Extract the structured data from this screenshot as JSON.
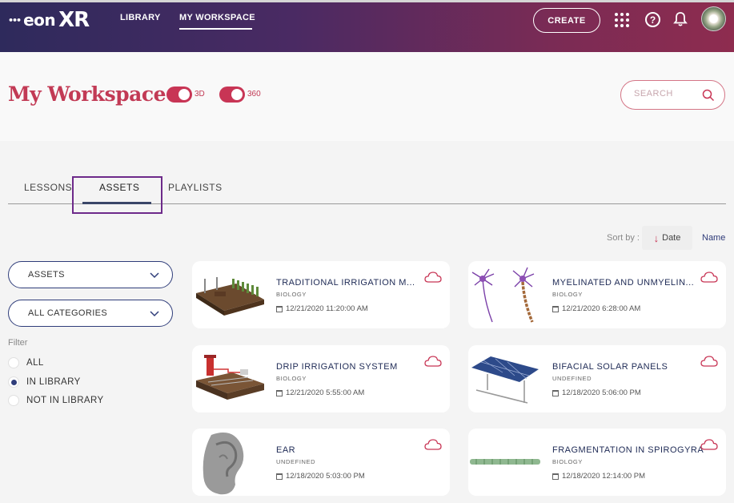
{
  "topbar": {
    "brand_mark": "•••",
    "brand_eon": "eon",
    "brand_xr": "XR",
    "nav": {
      "library": "LIBRARY",
      "workspace": "MY WORKSPACE"
    },
    "create_label": "CREATE",
    "help_glyph": "?"
  },
  "header": {
    "title": "My Workspace",
    "toggle_3d_label": "3D",
    "toggle_360_label": "360",
    "search_placeholder": "SEARCH"
  },
  "tabs": {
    "lessons": "LESSONS",
    "assets": "ASSETS",
    "playlists": "PLAYLISTS"
  },
  "sort": {
    "label": "Sort by :",
    "date": "Date",
    "name": "Name"
  },
  "filters": {
    "type_value": "ASSETS",
    "category_value": "ALL CATEGORIES",
    "label": "Filter",
    "options": [
      "ALL",
      "IN LIBRARY",
      "NOT IN LIBRARY"
    ],
    "selected": "IN LIBRARY"
  },
  "cards": [
    {
      "title": "TRADITIONAL IRRIGATION M...",
      "category": "BIOLOGY",
      "date": "12/21/2020 11:20:00 AM"
    },
    {
      "title": "MYELINATED AND UNMYELIN...",
      "category": "BIOLOGY",
      "date": "12/21/2020 6:28:00 AM"
    },
    {
      "title": "DRIP IRRIGATION SYSTEM",
      "category": "BIOLOGY",
      "date": "12/21/2020 5:55:00 AM"
    },
    {
      "title": "BIFACIAL SOLAR PANELS",
      "category": "UNDEFINED",
      "date": "12/18/2020 5:06:00 PM"
    },
    {
      "title": "EAR",
      "category": "UNDEFINED",
      "date": "12/18/2020 5:03:00 PM"
    },
    {
      "title": "FRAGMENTATION IN SPIROGYRA",
      "category": "BIOLOGY",
      "date": "12/18/2020 12:14:00 PM"
    }
  ],
  "colors": {
    "accent": "#c83555",
    "navy": "#2f3d7a",
    "highlight": "#6d2a8a"
  }
}
